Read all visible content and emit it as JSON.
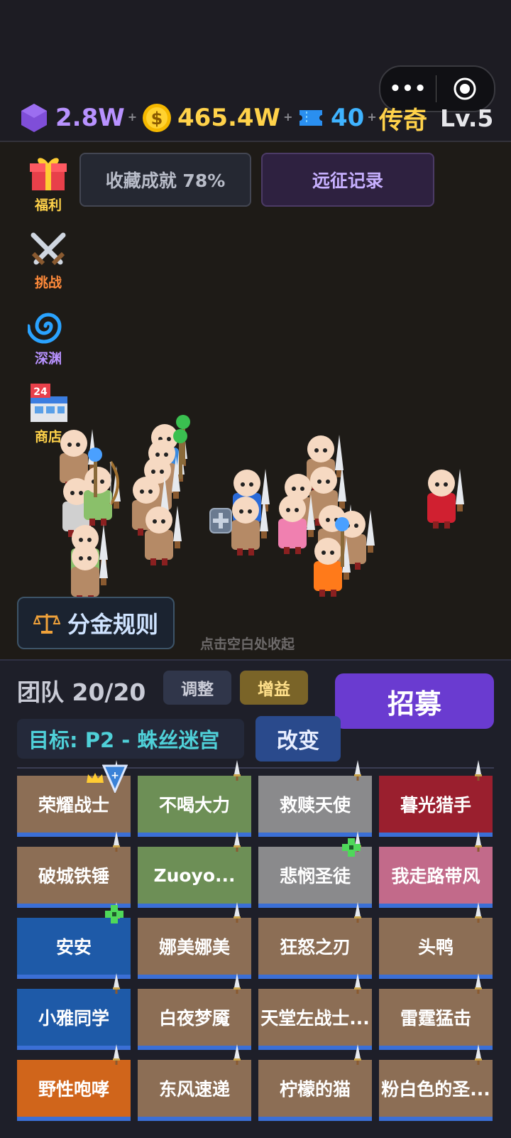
{
  "resources": {
    "gem": "2.8W",
    "coin": "465.4W",
    "ticket": "40",
    "plus": "+"
  },
  "rank": {
    "title": "传奇",
    "level": "Lv.5"
  },
  "capsule": {
    "menu": "•••"
  },
  "side_menu": [
    {
      "label": "福利",
      "icon": "gift-icon"
    },
    {
      "label": "挑战",
      "icon": "crossed-swords-icon"
    },
    {
      "label": "深渊",
      "icon": "swirl-icon"
    },
    {
      "label": "商店",
      "icon": "shop-icon",
      "badge": "24"
    }
  ],
  "top_buttons": {
    "achievements": "收藏成就 78%",
    "expedition": "远征记录"
  },
  "rules_button": "分金规则",
  "hint": "点击空白处收起",
  "team": {
    "label": "团队 20/20",
    "adjust": "调整",
    "buff": "增益",
    "recruit": "招募",
    "target": "目标: P2 - 蛛丝迷宫",
    "change": "改变"
  },
  "roster": [
    {
      "name": "荣耀战士",
      "color": "#8c6e55"
    },
    {
      "name": "不喝大力",
      "color": "#6d8f56"
    },
    {
      "name": "救赎天使",
      "color": "#8a8a8c"
    },
    {
      "name": "暮光猎手",
      "color": "#9a1f2e"
    },
    {
      "name": "破城铁锤",
      "color": "#8c6e55"
    },
    {
      "name": "Zuoyo...",
      "color": "#6d8f56"
    },
    {
      "name": "悲悯圣徒",
      "color": "#8a8a8c"
    },
    {
      "name": "我走路带风",
      "color": "#c26a8a"
    },
    {
      "name": "安安",
      "color": "#1e5aa8"
    },
    {
      "name": "娜美娜美",
      "color": "#8c6e55"
    },
    {
      "name": "狂怒之刃",
      "color": "#8c6e55"
    },
    {
      "name": "头鸭",
      "color": "#8c6e55"
    },
    {
      "name": "小雅同学",
      "color": "#1e5aa8"
    },
    {
      "name": "白夜梦魇",
      "color": "#8c6e55"
    },
    {
      "name": "天堂左战士...",
      "color": "#8c6e55"
    },
    {
      "name": "雷霆猛击",
      "color": "#8c6e55"
    },
    {
      "name": "野性咆哮",
      "color": "#d0651b"
    },
    {
      "name": "东风速递",
      "color": "#8c6e55"
    },
    {
      "name": "柠檬的猫",
      "color": "#8c6e55"
    },
    {
      "name": "粉白色的圣...",
      "color": "#8c6e55"
    }
  ],
  "colors": {
    "gem": "#b892ff",
    "coin": "#ffd24a",
    "ticket": "#3fb3ff",
    "rank": "#ffd24a"
  }
}
